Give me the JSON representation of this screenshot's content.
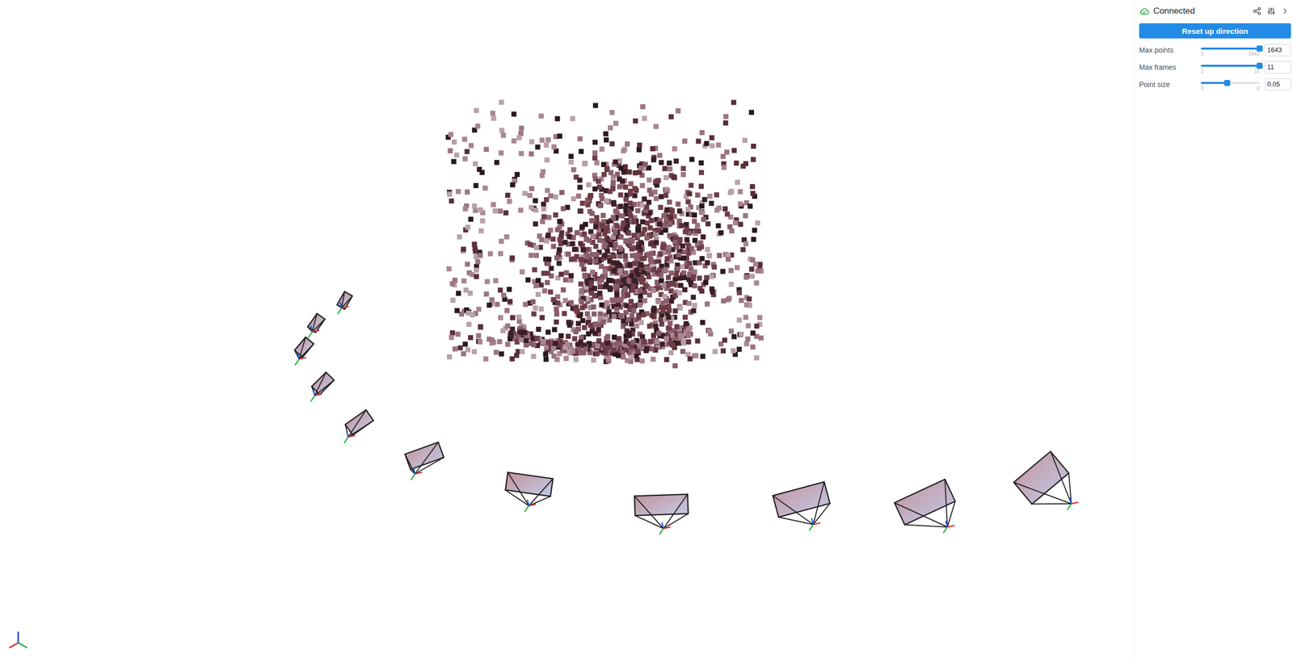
{
  "status": {
    "label": "Connected",
    "connected": true
  },
  "button": "Reset up direction",
  "controls": [
    {
      "label": "Max points",
      "kind": "slider",
      "level": 1,
      "value": "1643",
      "min": "1",
      "max": "1643"
    },
    {
      "label": "Max frames",
      "kind": "slider",
      "level": 1,
      "value": "11",
      "min": "1",
      "max": "11"
    },
    {
      "label": "Point size",
      "kind": "slider",
      "level": 0.45,
      "value": "0.05",
      "min": "0",
      "max": "0"
    }
  ]
}
